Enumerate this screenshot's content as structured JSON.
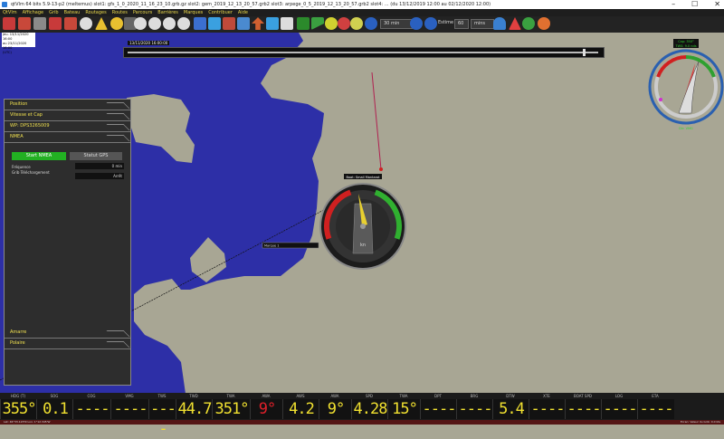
{
  "window": {
    "title": "qtVlm 64 bits 5.9-13-p2 (meltemus) slot1: gfs_1_0_2020_11_16_23_10.grb.gz slot2: gem_2019_12_13_20_57.grb2 slot3: arpege_0_5_2019_12_13_20_57.grb2 slot4: ... (du 13/12/2019 12:00 au 02/12/2020 12:00)"
  },
  "menu": [
    "QtVlm",
    "Affichage",
    "Grib",
    "Bateau",
    "Routages",
    "Routes",
    "Parcours",
    "Barrières",
    "Marques",
    "Contribuer",
    "Aide"
  ],
  "toolbar": {
    "step_value": "30 min",
    "estime_label": "Estime",
    "estime_value": "60",
    "estime_unit": "mins"
  },
  "date_info": {
    "line1": "jeu. 13/11/2020 16:00",
    "line2": "au 23/11/2020 16:00",
    "line3": "(UTC)"
  },
  "time_slider": {
    "label": "13/11/2020 16:00:00"
  },
  "panel": {
    "sections": [
      "Position",
      "Vitesse et Cap",
      "WP: DPS3265009",
      "NMEA"
    ],
    "start_button": "Start NMEA",
    "status_button": "Statut GPS",
    "freq_label": "Fréquence",
    "freq_value": "0 min",
    "gribdl_label": "Grib Téléchargement",
    "gribdl_value": "Arrêt",
    "bottom_sections": [
      "Amarre",
      "Polaire"
    ]
  },
  "boat_label": "Boat: Small Mantarot",
  "mini_label": "Marque 1",
  "compass": {
    "top_label1": "Cap: 350°",
    "top_label2": "TWS: 9.0 nds",
    "bottom_label": "Dir: VMG"
  },
  "instruments": [
    {
      "label": "HDG (T)",
      "value": "355°",
      "red": false
    },
    {
      "label": "SOG",
      "value": "0.1",
      "red": false
    },
    {
      "label": "COG",
      "value": "----",
      "red": false
    },
    {
      "label": "VMG",
      "value": "----",
      "red": false
    },
    {
      "label": "TWS",
      "value": "----",
      "red": false
    },
    {
      "label": "TWD",
      "value": "44.7",
      "red": false
    },
    {
      "label": "TWA",
      "value": "351°",
      "red": false
    },
    {
      "label": "AWA",
      "value": "9°",
      "red": true
    },
    {
      "label": "AWS",
      "value": "4.2",
      "red": false
    },
    {
      "label": "AWA",
      "value": "9°",
      "red": false
    },
    {
      "label": "SPD",
      "value": "4.28",
      "red": false
    },
    {
      "label": "TWA",
      "value": "15°",
      "red": false
    },
    {
      "label": "DPT",
      "value": "----",
      "red": false
    },
    {
      "label": "BRG",
      "value": "----",
      "red": false
    },
    {
      "label": "DTW",
      "value": "5.4",
      "red": false
    },
    {
      "label": "XTE",
      "value": "----",
      "red": false
    },
    {
      "label": "BOAT SPD",
      "value": "----",
      "red": false
    },
    {
      "label": "LOG",
      "value": "----",
      "red": false
    },
    {
      "label": "ETA",
      "value": "----",
      "red": false
    }
  ],
  "statusbar": {
    "left": "Lat: 46°33.123'N  Lon: 1°12.345'W",
    "right": "Ecran: Valeur du Grib: 0.0 kts"
  }
}
